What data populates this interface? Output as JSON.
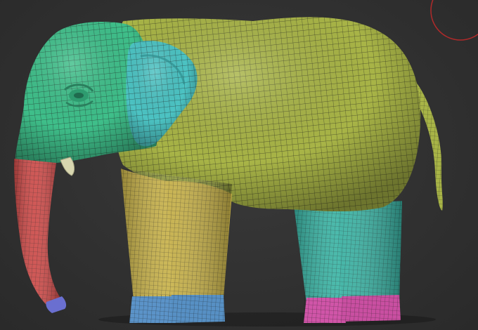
{
  "viewport": {
    "background_color": "#333333",
    "gizmo_ring_color": "#b02a2a",
    "model": {
      "subject": "elephant",
      "display": "polygroups-with-wireframe",
      "polygroup_colors": {
        "head": "#3fbf8a",
        "ear": "#4cc3c3",
        "body": "#a8b447",
        "front_legs": "#c8b24a",
        "hind_legs": "#3bb6a6",
        "trunk_tip": "#6a6fd0",
        "trunk": "#cc4a48",
        "front_feet": "#5b93c8",
        "hind_feet": "#d055a8",
        "tusk": "#d8d6b0"
      }
    }
  }
}
